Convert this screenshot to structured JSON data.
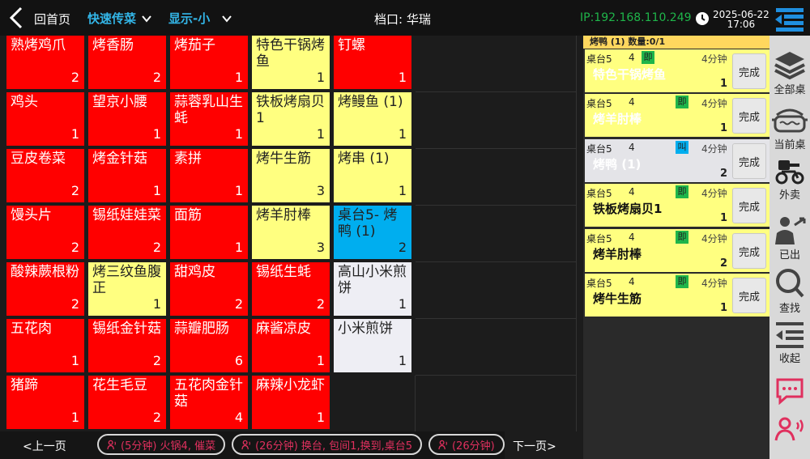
{
  "topbar": {
    "home": "回首页",
    "mode": "快速传菜",
    "display": "显示-小",
    "station": "档口: 华瑞",
    "ip": "IP:192.168.110.249",
    "date": "2025-06-22",
    "time": "17:06"
  },
  "cells": [
    {
      "name": "熟烤鸡爪",
      "qty": "2",
      "color": "red"
    },
    {
      "name": "烤香肠",
      "qty": "2",
      "color": "red"
    },
    {
      "name": "烤茄子",
      "qty": "1",
      "color": "red"
    },
    {
      "name": "特色干锅烤鱼",
      "qty": "1",
      "color": "yellow"
    },
    {
      "name": "钉螺",
      "qty": "1",
      "color": "red"
    },
    {
      "name": "",
      "qty": "",
      "color": "empty"
    },
    {
      "name": "鸡头",
      "qty": "1",
      "color": "red"
    },
    {
      "name": "望京小腰",
      "qty": "1",
      "color": "red"
    },
    {
      "name": "蒜蓉乳山生蚝",
      "qty": "1",
      "color": "red"
    },
    {
      "name": "铁板烤扇贝1",
      "qty": "1",
      "color": "yellow"
    },
    {
      "name": "烤鳗鱼 (1)",
      "qty": "1",
      "color": "yellow"
    },
    {
      "name": "",
      "qty": "",
      "color": "empty"
    },
    {
      "name": "豆皮卷菜",
      "qty": "2",
      "color": "red"
    },
    {
      "name": "烤金针菇",
      "qty": "1",
      "color": "red"
    },
    {
      "name": "素拼",
      "qty": "1",
      "color": "red"
    },
    {
      "name": "烤牛生筋",
      "qty": "3",
      "color": "yellow"
    },
    {
      "name": "烤串 (1)",
      "qty": "1",
      "color": "yellow"
    },
    {
      "name": "",
      "qty": "",
      "color": "empty"
    },
    {
      "name": "馒头片",
      "qty": "2",
      "color": "red"
    },
    {
      "name": "锡纸娃娃菜",
      "qty": "2",
      "color": "red"
    },
    {
      "name": "面筋",
      "qty": "1",
      "color": "red"
    },
    {
      "name": "烤羊肘棒",
      "qty": "3",
      "color": "yellow"
    },
    {
      "name": "桌台5- 烤鸭 (1)",
      "qty": "2",
      "color": "blue"
    },
    {
      "name": "",
      "qty": "",
      "color": "empty"
    },
    {
      "name": "酸辣蕨根粉",
      "qty": "2",
      "color": "red"
    },
    {
      "name": "烤三纹鱼腹正",
      "qty": "1",
      "color": "yellow"
    },
    {
      "name": "甜鸡皮",
      "qty": "2",
      "color": "red"
    },
    {
      "name": "锡纸生蚝",
      "qty": "2",
      "color": "red"
    },
    {
      "name": "高山小米煎饼",
      "qty": "1",
      "color": "white"
    },
    {
      "name": "",
      "qty": "",
      "color": "empty"
    },
    {
      "name": "五花肉",
      "qty": "1",
      "color": "red"
    },
    {
      "name": "锡纸金针菇",
      "qty": "2",
      "color": "red"
    },
    {
      "name": "蒜瓣肥肠",
      "qty": "6",
      "color": "red"
    },
    {
      "name": "麻酱凉皮",
      "qty": "1",
      "color": "red"
    },
    {
      "name": "小米煎饼",
      "qty": "1",
      "color": "white"
    },
    {
      "name": "",
      "qty": "",
      "color": "empty"
    },
    {
      "name": "猪蹄",
      "qty": "1",
      "color": "red"
    },
    {
      "name": "花生毛豆",
      "qty": "2",
      "color": "red"
    },
    {
      "name": "五花肉金针菇",
      "qty": "4",
      "color": "red"
    },
    {
      "name": "麻辣小龙虾",
      "qty": "1",
      "color": "red"
    },
    {
      "name": "",
      "qty": "",
      "color": "empty"
    },
    {
      "name": "",
      "qty": "",
      "color": "empty"
    }
  ],
  "bottombar": {
    "prev": "<上一页",
    "next": "下一页>",
    "messages": [
      "(5分钟) 火锅4, 催菜",
      "(26分钟) 换台, 包间1,换到,桌台5",
      "(26分钟)"
    ]
  },
  "panel": {
    "header": "烤鸭 (1) 数量:0/1",
    "done_label": "完成",
    "orders": [
      {
        "table": "桌台5",
        "count": "4",
        "badge": "即",
        "badge_color": "#1fb54a",
        "minutes": "4分钟",
        "dish": "特色干锅烤鱼",
        "qty": "1",
        "style": "yellow",
        "dish_tone": "ghost"
      },
      {
        "table": "桌台5",
        "count": "4",
        "badge": "即",
        "badge_color": "#1fb54a",
        "minutes": "4分钟",
        "dish": "烤羊肘棒",
        "qty": "1",
        "style": "yellow",
        "dish_tone": "ghost"
      },
      {
        "table": "桌台5",
        "count": "4",
        "badge": "叫",
        "badge_color": "#00aeef",
        "minutes": "4分钟",
        "dish": "烤鸭 (1)",
        "qty": "2",
        "style": "white",
        "dish_tone": "ghost"
      },
      {
        "table": "桌台5",
        "count": "4",
        "badge": "即",
        "badge_color": "#1fb54a",
        "minutes": "4分钟",
        "dish": "铁板烤扇贝1",
        "qty": "1",
        "style": "yellow",
        "dish_tone": "dark"
      },
      {
        "table": "桌台5",
        "count": "4",
        "badge": "即",
        "badge_color": "#1fb54a",
        "minutes": "4分钟",
        "dish": "烤羊肘棒",
        "qty": "2",
        "style": "yellow",
        "dish_tone": "dark"
      },
      {
        "table": "桌台5",
        "count": "4",
        "badge": "即",
        "badge_color": "#1fb54a",
        "minutes": "4分钟",
        "dish": "烤牛生筋",
        "qty": "1",
        "style": "yellow",
        "dish_tone": "dark"
      }
    ]
  },
  "sidebar": {
    "items": [
      {
        "label": "全部桌",
        "icon": "layers-icon"
      },
      {
        "label": "当前桌",
        "icon": "pot-icon"
      },
      {
        "label": "外卖",
        "icon": "scooter-icon"
      },
      {
        "label": "已出",
        "icon": "person-out-icon"
      },
      {
        "label": "查找",
        "icon": "search-icon"
      },
      {
        "label": "收起",
        "icon": "collapse-icon"
      },
      {
        "label": "",
        "icon": "chat-icon"
      },
      {
        "label": "",
        "icon": "voice-user-icon"
      }
    ]
  },
  "colors": {
    "red": "#ff0000",
    "yellow": "#ffff80",
    "blue": "#00aeef",
    "white": "#eeeef4",
    "accent": "#33b6e8",
    "ip_green": "#1fb54a",
    "message_pink": "#e0305e"
  }
}
